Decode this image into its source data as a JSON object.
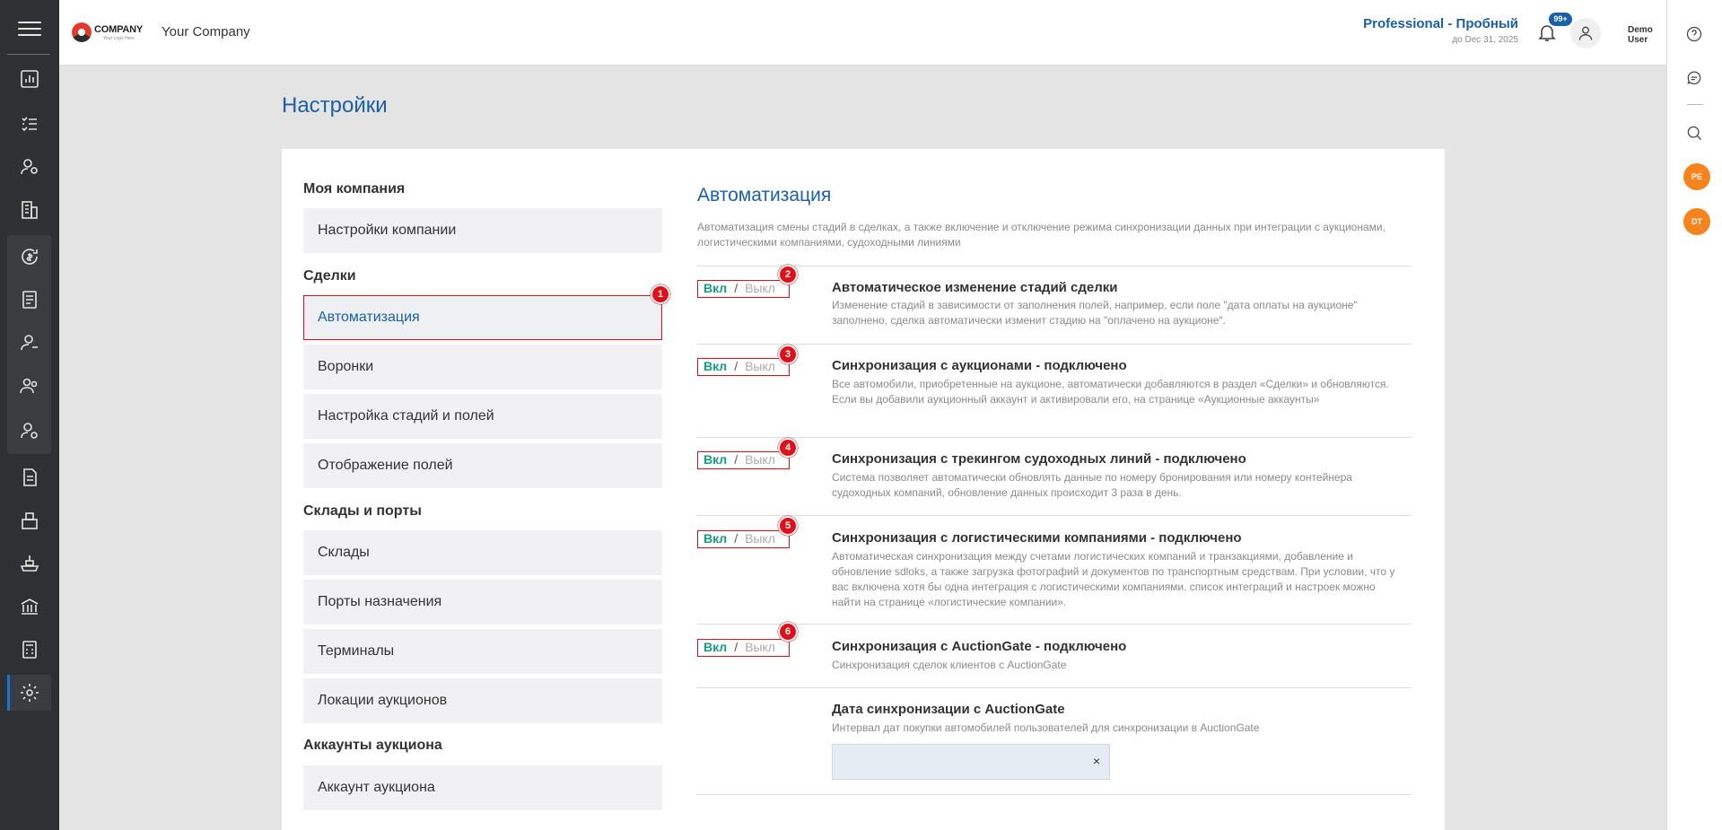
{
  "topbar": {
    "logo_text": "COMPANY",
    "logo_sub": "Your Logo Here",
    "company_name": "Your Company",
    "plan": "Professional - Пробный",
    "plan_until": "до Dec 31, 2025",
    "notifications_badge": "99+",
    "user_line1": "Demo",
    "user_line2": "User"
  },
  "right_sidebar": {
    "initials": [
      "PE",
      "DT"
    ]
  },
  "page": {
    "title": "Настройки"
  },
  "nav": {
    "sections": [
      "Моя компания",
      "Сделки",
      "Склады и порты",
      "Аккаунты аукциона"
    ],
    "items": [
      "Настройки компании",
      "Автоматизация",
      "Воронки",
      "Настройка стадий и полей",
      "Отображение полей",
      "Склады",
      "Порты назначения",
      "Терминалы",
      "Локации аукционов",
      "Аккаунт аукциона"
    ],
    "active": "Автоматизация"
  },
  "markers": [
    "1",
    "2",
    "3",
    "4",
    "5",
    "6"
  ],
  "content": {
    "title": "Автоматизация",
    "description": "Автоматизация смены стадий в сделках, а также включение и отключение режима синхронизации данных при интеграции с аукционами, логистическими компаниями, судоходными линиями",
    "toggle_on": "Вкл",
    "toggle_sep": "/",
    "toggle_off": "Выкл",
    "rows": [
      {
        "title": "Автоматическое изменение стадий сделки",
        "desc": "Изменение стадий в зависимости от заполнения полей, например, если поле \"дата оплаты на аукционе\" заполнено, сделка автоматически изменит стадию на \"оплачено на аукционе\"."
      },
      {
        "title": "Синхронизация с аукционами - подключено",
        "desc": "Все автомобили, приобретенные на аукционе, автоматически добавляются в раздел «Сделки» и обновляются. Если вы добавили аукционный аккаунт и активировали его, на странице «Аукционные аккаунты»"
      },
      {
        "title": "Синхронизация с трекингом судоходных линий - подключено",
        "desc": "Система позволяет автоматически обновлять данные по номеру бронирования или номеру контейнера судоходных компаний, обновление данных происходит 3 раза в день."
      },
      {
        "title": "Синхронизация с логистическими компаниями - подключено",
        "desc": "Автоматическая синхронизация между счетами логистических компаний и транзакциями, добавление и обновление sdloks, а также загрузка фотографий и документов по транспортным средствам. При условии, что у вас включена хотя бы одна интеграция с логистическими компаниями. список интеграций и настроек можно найти на странице «логистические компании»."
      },
      {
        "title": "Синхронизация с AuctionGate - подключено",
        "desc": "Синхронизация сделок клиентов с AuctionGate"
      },
      {
        "title": "Дата синхронизации с AuctionGate",
        "desc": "Интервал дат покупки автомобилей пользователей для синхронизации в AuctionGate"
      }
    ],
    "date_clear": "×"
  }
}
